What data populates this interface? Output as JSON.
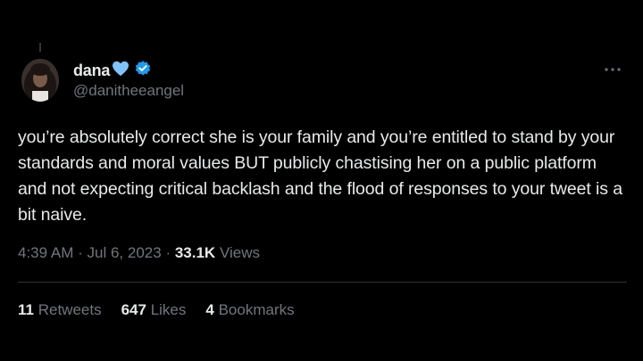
{
  "user": {
    "display_name": "dana",
    "handle": "@danitheeangel",
    "emoji_icon": "light-blue-heart-icon",
    "badge_icon": "verified-badge-icon",
    "badge_color": "#1d9bf0",
    "heart_color": "#7fc3ff"
  },
  "tweet": {
    "text": "you’re absolutely correct she is your family and you’re entitled to stand by your standards and moral values BUT publicly chastising her on a public platform and not expecting critical backlash and the flood of responses to your tweet is a bit naive.",
    "time": "4:39 AM",
    "separator": "·",
    "date": "Jul 6, 2023",
    "views_count": "33.1K",
    "views_label": "Views"
  },
  "stats": {
    "retweets_count": "11",
    "retweets_label": "Retweets",
    "likes_count": "647",
    "likes_label": "Likes",
    "bookmarks_count": "4",
    "bookmarks_label": "Bookmarks"
  },
  "colors": {
    "background": "#000000",
    "text_primary": "#e7e9ea",
    "text_secondary": "#71767b",
    "divider": "#2f3336"
  }
}
